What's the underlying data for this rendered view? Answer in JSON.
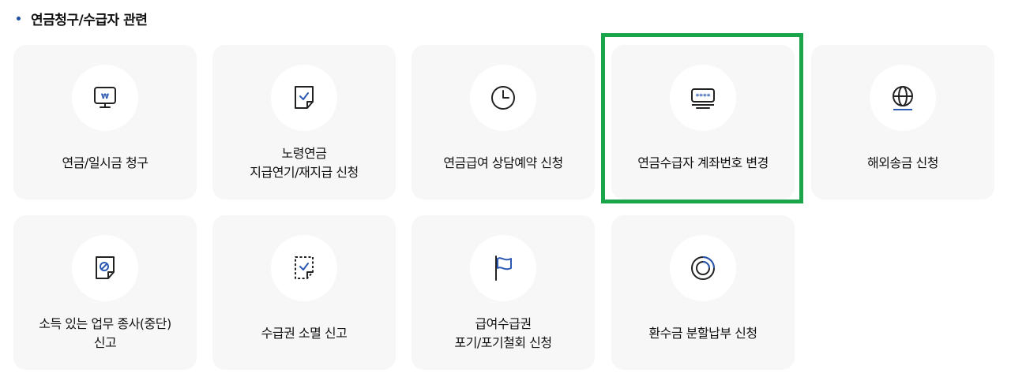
{
  "section": {
    "title": "연금청구/수급자 관련"
  },
  "cards": [
    {
      "icon": "monitor-won-icon",
      "lines": [
        "연금/일시금 청구"
      ]
    },
    {
      "icon": "document-check-icon",
      "lines": [
        "노령연금",
        "지급연기/재지급 신청"
      ]
    },
    {
      "icon": "clock-icon",
      "lines": [
        "연금급여 상담예약 신청"
      ]
    },
    {
      "icon": "password-monitor-icon",
      "lines": [
        "연금수급자 계좌번호 변경"
      ]
    },
    {
      "icon": "globe-icon",
      "lines": [
        "해외송금 신청"
      ]
    },
    {
      "icon": "document-prohibited-icon",
      "lines": [
        "소득 있는 업무 종사(중단)",
        "신고"
      ]
    },
    {
      "icon": "dashed-document-check-icon",
      "lines": [
        "수급권 소멸 신고"
      ]
    },
    {
      "icon": "flag-icon",
      "lines": [
        "급여수급권",
        "포기/포기철회 신청"
      ]
    },
    {
      "icon": "ring-icon",
      "lines": [
        "환수금 분할납부 신청"
      ]
    }
  ],
  "highlight": {
    "target": "연금수급자 계좌번호 변경",
    "color": "#1aa54a"
  },
  "colors": {
    "card_bg": "#f7f7f7",
    "icon_dark": "#222222",
    "icon_accent": "#2b59b3",
    "bullet": "#1f4f9e"
  }
}
